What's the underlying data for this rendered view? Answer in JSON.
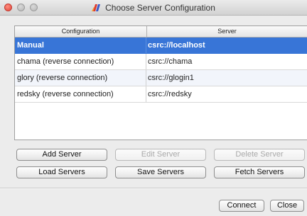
{
  "window": {
    "title": "Choose Server Configuration",
    "app_icon": "paraview-logo-icon"
  },
  "table": {
    "columns": [
      "Configuration",
      "Server"
    ],
    "rows": [
      {
        "configuration": "Manual",
        "server": "csrc://localhost",
        "selected": true
      },
      {
        "configuration": "chama (reverse connection)",
        "server": "csrc://chama",
        "selected": false
      },
      {
        "configuration": "glory (reverse connection)",
        "server": "csrc://glogin1",
        "selected": false
      },
      {
        "configuration": "redsky (reverse connection)",
        "server": "csrc://redsky",
        "selected": false
      }
    ]
  },
  "buttons": {
    "add_server": "Add Server",
    "edit_server": "Edit Server",
    "delete_server": "Delete Server",
    "load_servers": "Load Servers",
    "save_servers": "Save Servers",
    "fetch_servers": "Fetch Servers",
    "connect": "Connect",
    "close": "Close"
  },
  "colors": {
    "selection": "#3875d7",
    "window_background": "#ececec"
  }
}
